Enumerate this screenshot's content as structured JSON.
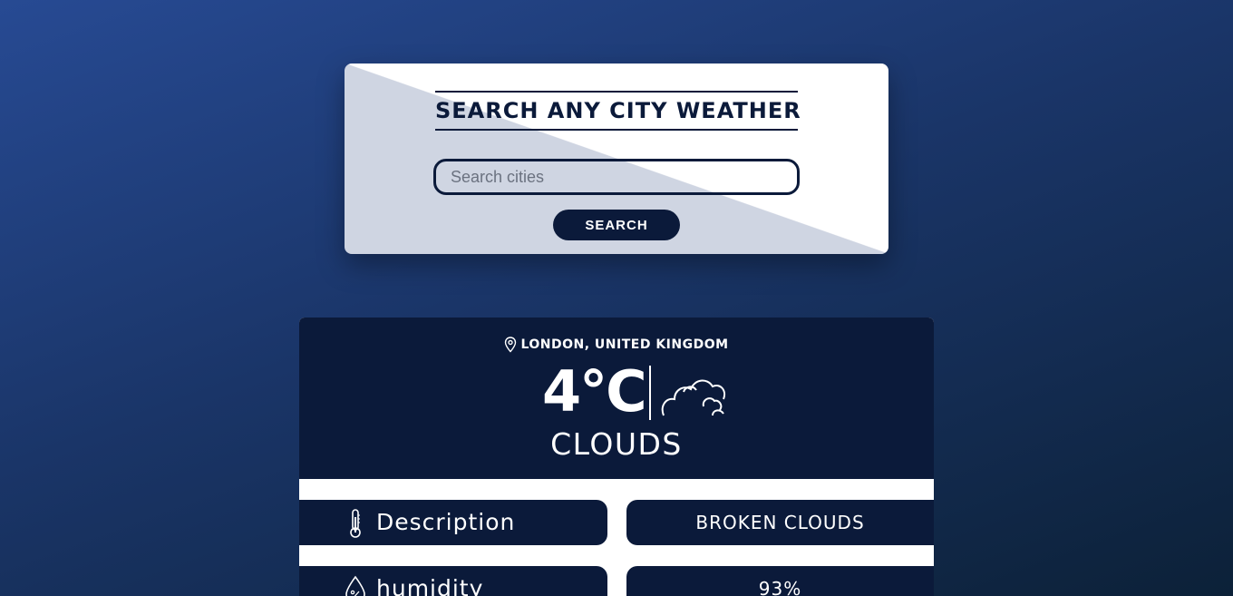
{
  "search": {
    "title": "SEARCH ANY CITY WEATHER",
    "placeholder": "Search cities",
    "value": "",
    "button_label": "SEARCH"
  },
  "weather": {
    "location": "LONDON, UNITED KINGDOM",
    "temperature": "4°C",
    "condition": "CLOUDS",
    "details": [
      {
        "label": "Description",
        "value": "BROKEN CLOUDS",
        "icon": "thermometer-icon"
      },
      {
        "label": "humidity",
        "value": "93%",
        "icon": "humidity-icon"
      }
    ]
  },
  "colors": {
    "navy": "#0b1a3a",
    "card_light": "#cfd5e2",
    "background_top": "#274a93",
    "background_bottom": "#0c2138"
  }
}
